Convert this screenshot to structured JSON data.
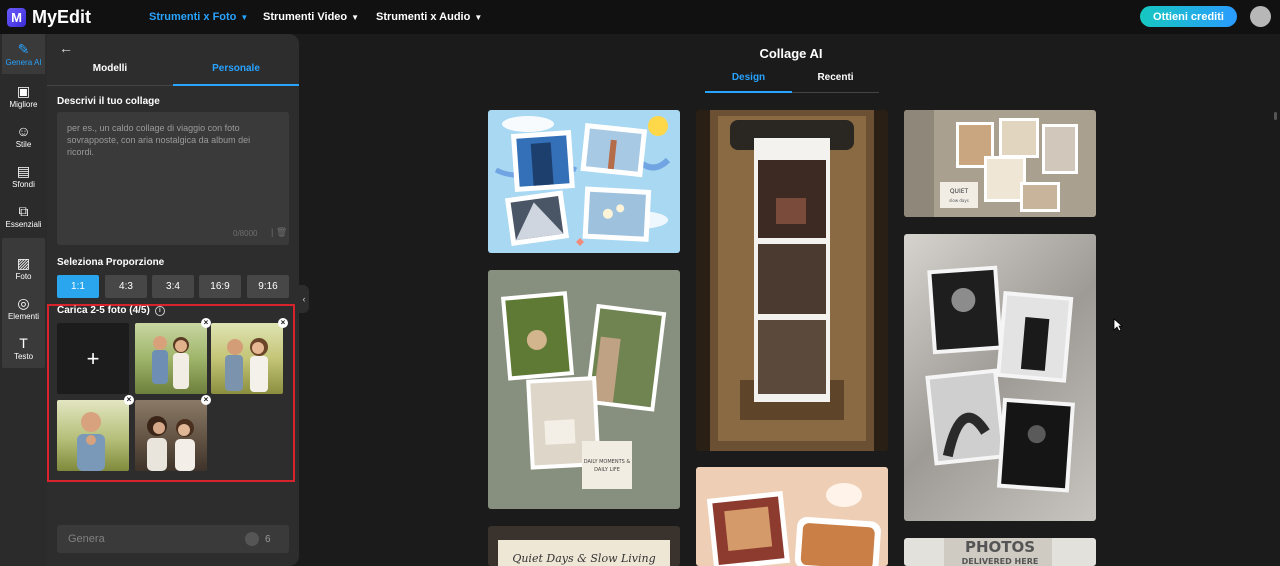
{
  "brand": {
    "name": "MyEdit",
    "logo_letter": "M"
  },
  "top_nav": [
    {
      "label": "Strumenti x Foto",
      "active": true
    },
    {
      "label": "Strumenti Video",
      "active": false
    },
    {
      "label": "Strumenti x Audio",
      "active": false
    }
  ],
  "credits_button": "Ottieni crediti",
  "sidebar": {
    "items": [
      {
        "label": "Genera AI",
        "icon": "magic-wand-icon",
        "active": true
      },
      {
        "label": "Migliore",
        "icon": "image-enhance-icon"
      },
      {
        "label": "Stile",
        "icon": "portrait-style-icon"
      },
      {
        "label": "Sfondi",
        "icon": "background-icon"
      },
      {
        "label": "Essenziali",
        "icon": "crop-icon"
      },
      {
        "label": "Foto",
        "icon": "photo-icon"
      },
      {
        "label": "Elementi",
        "icon": "shapes-icon"
      },
      {
        "label": "Testo",
        "icon": "text-icon"
      }
    ]
  },
  "panel": {
    "tabs": [
      "Modelli",
      "Personale"
    ],
    "active_tab": "Personale",
    "describe_title": "Descrivi il tuo collage",
    "describe_placeholder": "per es., un caldo collage di viaggio con foto sovrapposte, con aria nostalgica da album dei ricordi.",
    "char_counter": "0/8000",
    "ratio_title": "Seleziona Proporzione",
    "ratios": [
      "1:1",
      "4:3",
      "3:4",
      "16:9",
      "9:16"
    ],
    "active_ratio": "1:1",
    "upload_title": "Carica 2-5 foto (4/5)",
    "uploaded_count": 4,
    "generate_label": "Genera",
    "generate_cost": "6"
  },
  "main": {
    "title": "Collage AI",
    "tabs": [
      "Design",
      "Recenti"
    ],
    "active_tab": "Design",
    "template_texts": {
      "quiet": "QUIET",
      "quiet_sub": "slow days",
      "daily_moments": "DAILY MOMENTS & DAILY LIFE",
      "quiet_days": "Quiet Days & Slow Living",
      "photos": "PHOTOS",
      "delivered_here": "DELIVERED HERE"
    }
  },
  "colors": {
    "accent": "#28a3ff",
    "highlight_frame": "#d6232c",
    "panel": "#2d2d2d",
    "bg": "#1b1b1b"
  }
}
